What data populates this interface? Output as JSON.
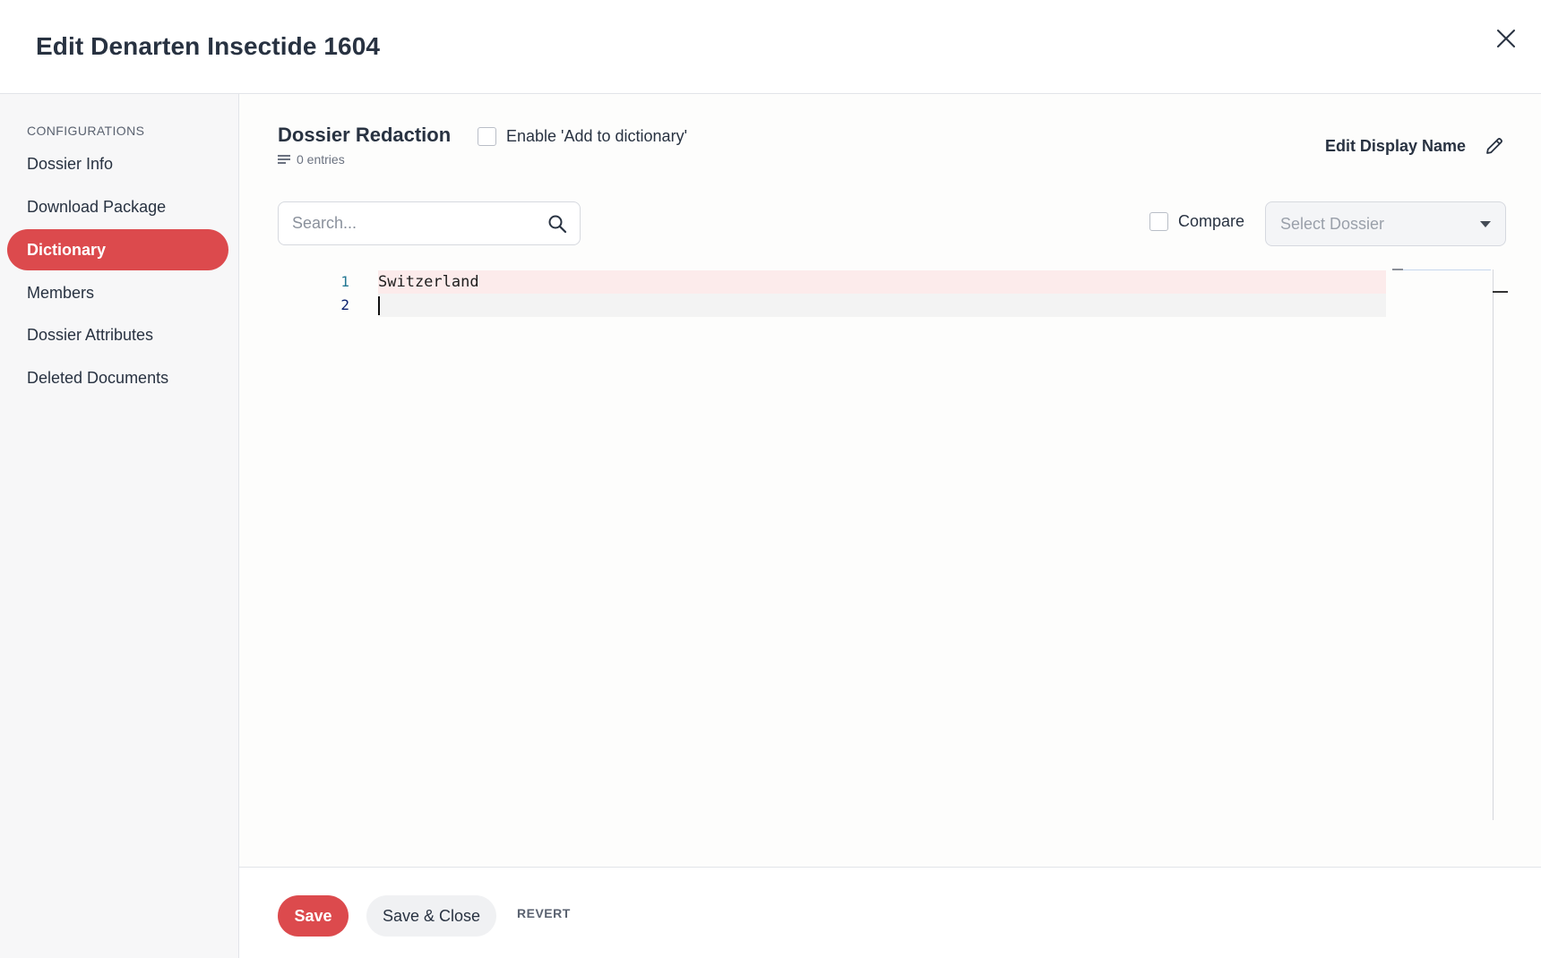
{
  "header": {
    "title": "Edit Denarten Insectide 1604"
  },
  "sidebar": {
    "heading": "CONFIGURATIONS",
    "items": [
      {
        "label": "Dossier Info",
        "active": false
      },
      {
        "label": "Download Package",
        "active": false
      },
      {
        "label": "Dictionary",
        "active": true
      },
      {
        "label": "Members",
        "active": false
      },
      {
        "label": "Dossier Attributes",
        "active": false
      },
      {
        "label": "Deleted Documents",
        "active": false
      }
    ]
  },
  "main": {
    "title": "Dossier Redaction",
    "entries": "0 entries",
    "enable_label": "Enable 'Add to dictionary'",
    "edit_display_label": "Edit Display Name",
    "search_placeholder": "Search...",
    "compare_label": "Compare",
    "select_placeholder": "Select Dossier"
  },
  "editor": {
    "lines": [
      {
        "number": "1",
        "text": "Switzerland"
      },
      {
        "number": "2",
        "text": ""
      }
    ]
  },
  "footer": {
    "save_label": "Save",
    "save_close_label": "Save & Close",
    "revert_label": "REVERT"
  },
  "colors": {
    "accent": "#dc4a4d",
    "text": "#283241",
    "line_highlight": "#fcebeb"
  }
}
